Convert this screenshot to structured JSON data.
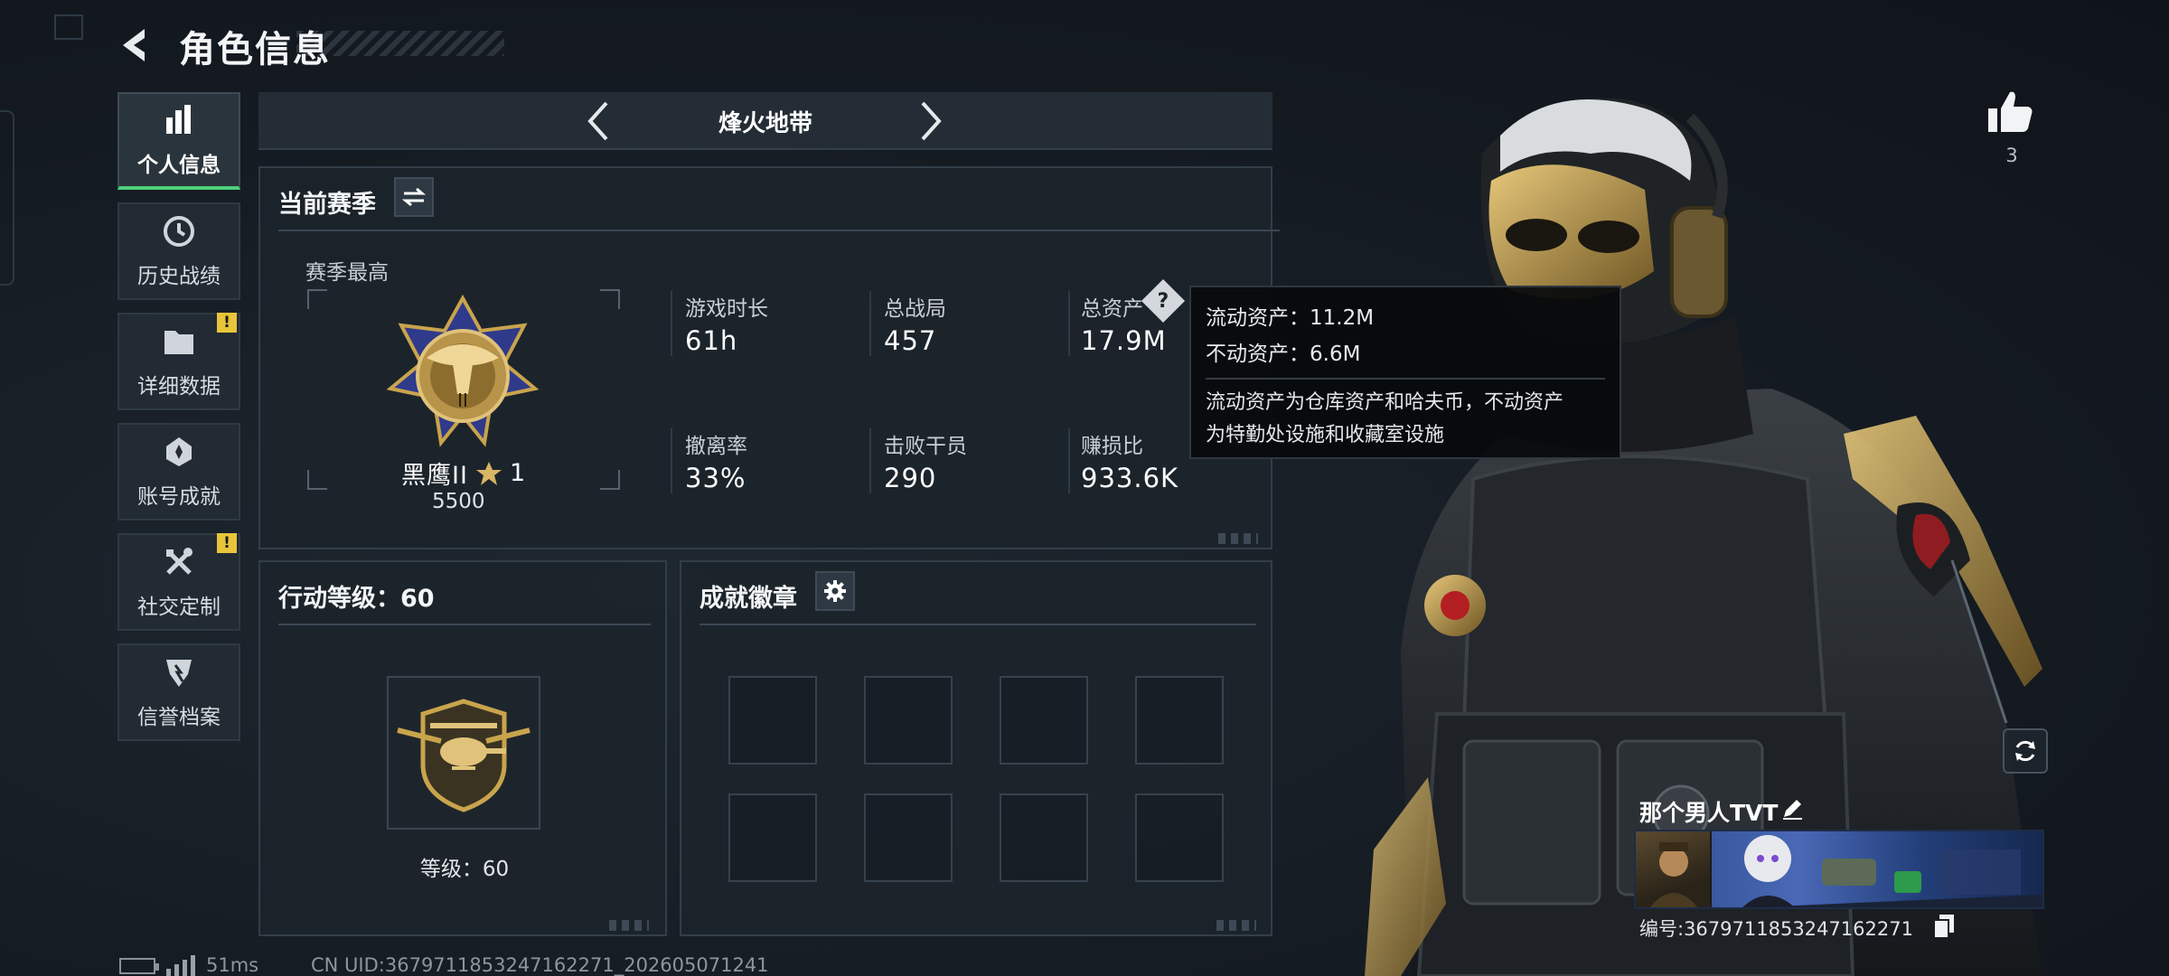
{
  "header": {
    "title": "角色信息"
  },
  "sidebar": {
    "items": [
      {
        "label": "个人信息",
        "icon": "bar-chart-icon",
        "active": true,
        "warning": false
      },
      {
        "label": "历史战绩",
        "icon": "history-clock-icon",
        "active": false,
        "warning": false
      },
      {
        "label": "详细数据",
        "icon": "folder-icon",
        "active": false,
        "warning": true
      },
      {
        "label": "账号成就",
        "icon": "achievement-badge-icon",
        "active": false,
        "warning": false
      },
      {
        "label": "社交定制",
        "icon": "tools-icon",
        "active": false,
        "warning": true
      },
      {
        "label": "信誉档案",
        "icon": "reputation-shield-icon",
        "active": false,
        "warning": false
      }
    ],
    "warning_glyph": "!"
  },
  "mode": {
    "title": "烽火地带"
  },
  "season": {
    "title": "当前赛季",
    "best_label": "赛季最高",
    "rank_name": "黑鹰II",
    "rank_stars": "1",
    "rank_points": "5500",
    "stats": [
      {
        "label": "游戏时长",
        "value": "61h"
      },
      {
        "label": "总战局",
        "value": "457"
      },
      {
        "label": "总资产",
        "value": "17.9M"
      },
      {
        "label": "撤离率",
        "value": "33%"
      },
      {
        "label": "击败干员",
        "value": "290"
      },
      {
        "label": "赚损比",
        "value": "933.6K"
      }
    ]
  },
  "tooltip": {
    "liquid": "流动资产：11.2M",
    "fixed": "不动资产：6.6M",
    "desc_line1": "流动资产为仓库资产和哈夫币，不动资产",
    "desc_line2": "为特勤处设施和收藏室设施",
    "help_glyph": "?"
  },
  "action_level": {
    "title": "行动等级：60",
    "level_text": "等级：60"
  },
  "badges": {
    "title": "成就徽章",
    "slots": 8
  },
  "player": {
    "likes": "3",
    "name": "那个男人TVT",
    "uid_line": "编号:3679711853247162271"
  },
  "status_bar": {
    "ping": "51ms",
    "cn_uid": "CN UID:3679711853247162271_202605071241"
  },
  "colors": {
    "accent_green": "#4ed07a",
    "warning_yellow": "#e8c53a",
    "gold": "#c9a44c"
  }
}
